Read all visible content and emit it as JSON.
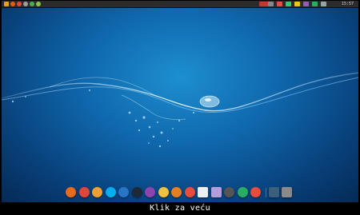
{
  "clock": {
    "time": "15:57"
  },
  "caption": {
    "text": "Klik za veću"
  },
  "topbar_left_icons": [
    {
      "name": "menu-icon",
      "color": "#e3a21a"
    },
    {
      "name": "firefox-icon",
      "color": "#e66000"
    },
    {
      "name": "chrome-icon",
      "color": "#dd4b39"
    },
    {
      "name": "files-icon",
      "color": "#9e9e9e"
    },
    {
      "name": "terminal-icon",
      "color": "#4caf50"
    },
    {
      "name": "settings-icon",
      "color": "#8bc34a"
    }
  ],
  "topbar_right_icons": [
    {
      "name": "battery-red-icon",
      "color": "#c0392b"
    },
    {
      "name": "network-icon",
      "color": "#7f8c8d"
    },
    {
      "name": "chat-icon",
      "color": "#e74c3c"
    },
    {
      "name": "update-icon",
      "color": "#2ecc71"
    },
    {
      "name": "sync-icon",
      "color": "#f1c40f"
    },
    {
      "name": "sound-icon",
      "color": "#9b59b6"
    },
    {
      "name": "cpu-graph-icon",
      "color": "#27ae60"
    },
    {
      "name": "power-icon",
      "color": "#95a5a6"
    }
  ],
  "dock": [
    {
      "name": "firefox-icon",
      "color": "#e76b1c"
    },
    {
      "name": "chrome-icon",
      "color": "#e2463a"
    },
    {
      "name": "software-center-icon",
      "color": "#f0a030"
    },
    {
      "name": "skype-icon",
      "color": "#00aff0"
    },
    {
      "name": "kodi-icon",
      "color": "#2a74c8"
    },
    {
      "name": "minus-icon",
      "color": "#1d2a3a"
    },
    {
      "name": "media-player-icon",
      "color": "#8e44ad"
    },
    {
      "name": "video-player-icon",
      "color": "#f0c040"
    },
    {
      "name": "music-icon",
      "color": "#e67e22"
    },
    {
      "name": "youtube-icon",
      "color": "#e74c3c"
    },
    {
      "name": "document-icon",
      "color": "#ecf0f1"
    },
    {
      "name": "ebook-icon",
      "color": "#b39ddb"
    },
    {
      "name": "system-icon",
      "color": "#555555"
    },
    {
      "name": "photos-icon",
      "color": "#27ae60"
    },
    {
      "name": "recycle-icon",
      "color": "#e74c3c"
    },
    {
      "name": "apps-icon",
      "color": "#3a5f7a"
    },
    {
      "name": "trash-icon",
      "color": "#8a8a8a"
    }
  ]
}
